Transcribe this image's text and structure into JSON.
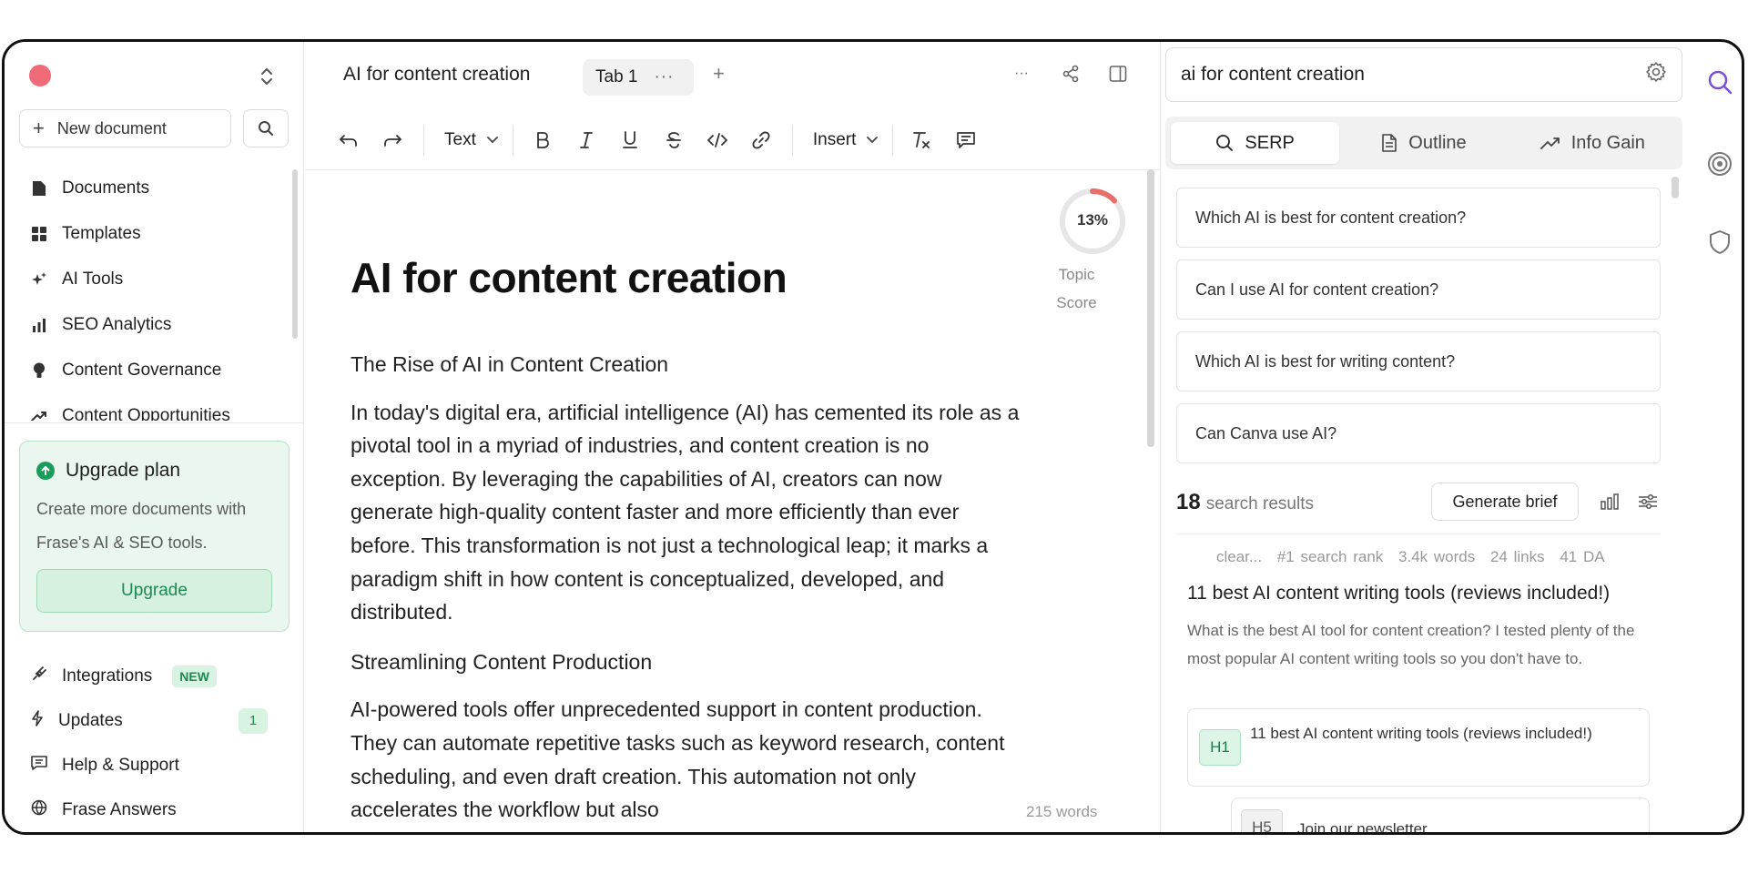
{
  "sidebar": {
    "new_document": "New document",
    "nav": [
      {
        "label": "Documents",
        "icon": "file-icon"
      },
      {
        "label": "Templates",
        "icon": "grid-icon"
      },
      {
        "label": "AI Tools",
        "icon": "sparkles-icon"
      },
      {
        "label": "SEO Analytics",
        "icon": "bar-chart-icon"
      },
      {
        "label": "Content Governance",
        "icon": "lightbulb-icon"
      },
      {
        "label": "Content Opportunities",
        "icon": "trending-up-icon"
      }
    ],
    "upgrade": {
      "title": "Upgrade plan",
      "text": "Create more documents with Frase's AI & SEO tools.",
      "button": "Upgrade"
    },
    "bottom": [
      {
        "label": "Integrations",
        "icon": "plug-icon",
        "badge": "NEW"
      },
      {
        "label": "Updates",
        "icon": "bolt-icon",
        "count": "1"
      },
      {
        "label": "Help & Support",
        "icon": "chat-icon"
      },
      {
        "label": "Frase Answers",
        "icon": "globe-icon"
      }
    ],
    "colors": {
      "window_dot": "#f06b78",
      "accent_green": "#1a9c5b"
    }
  },
  "editor": {
    "doc_title": "AI for content creation",
    "tab_label": "Tab 1",
    "toolbar": {
      "text_style": "Text",
      "insert": "Insert"
    },
    "topic_score": "13%",
    "topic_score_value": 13,
    "topic_score_label": "Topic Score",
    "heading": "AI for content creation",
    "sections": {
      "sub1": "The Rise of AI in Content Creation",
      "p1": "In today's digital era, artificial intelligence (AI) has cemented its role as a pivotal tool in a myriad of industries, and content creation is no exception. By leveraging the capabilities of AI, creators can now generate high-quality content faster and more efficiently than ever before. This transformation is not just a technological leap; it marks a paradigm shift in how content is conceptualized, developed, and distributed.",
      "sub2": "Streamlining Content Production",
      "p2": "AI-powered tools offer unprecedented support in content production. They can automate repetitive tasks such as keyword research, content scheduling, and even draft creation. This automation not only accelerates the workflow but also"
    },
    "word_count": "215 words"
  },
  "research": {
    "query": "ai for content creation",
    "tabs": [
      "SERP",
      "Outline",
      "Info Gain"
    ],
    "questions": [
      "Which AI is best for content creation?",
      "Can I use AI for content creation?",
      "Which AI is best for writing content?",
      "Can Canva use AI?"
    ],
    "results_count": "18",
    "results_label": "search results",
    "generate_brief": "Generate brief",
    "result": {
      "meta": [
        "clear...",
        "#1 search rank",
        "3.4k words",
        "24 links",
        "41 DA"
      ],
      "title": "11 best AI content writing tools (reviews included!)",
      "description": "What is the best AI tool for content creation? I tested plenty of the most popular AI content writing tools so you don't have to.",
      "headings": [
        {
          "tag": "H1",
          "text": "11 best AI content writing tools (reviews included!)"
        },
        {
          "tag": "H5",
          "text": "Join our newsletter"
        }
      ]
    }
  }
}
